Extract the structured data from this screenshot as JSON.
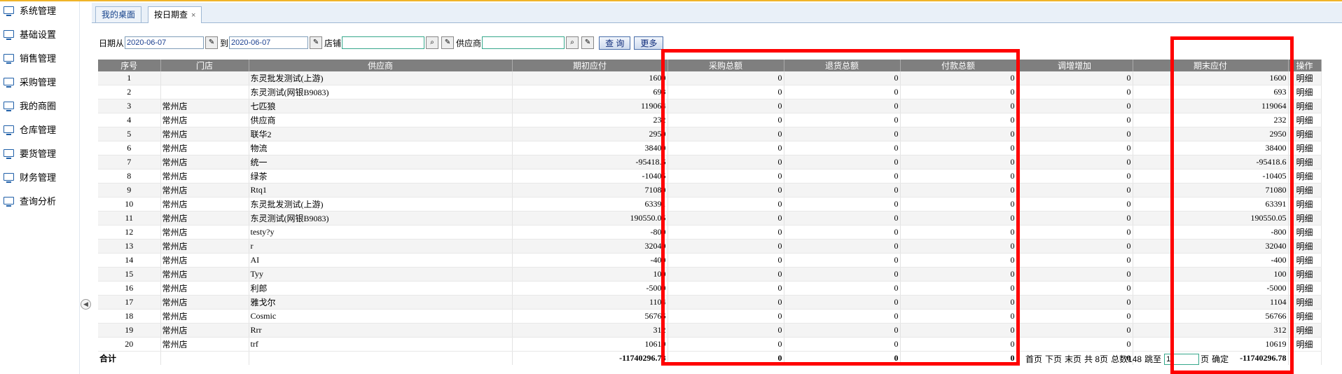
{
  "colors": {
    "accent": "#f0b429",
    "highlight": "#ff0000",
    "header_bg": "#7f7f7f",
    "nav_icon": "#1f5fa8"
  },
  "sidebar": {
    "items": [
      {
        "label": "系统管理",
        "icon": "monitor-icon"
      },
      {
        "label": "基础设置",
        "icon": "monitor-icon"
      },
      {
        "label": "销售管理",
        "icon": "monitor-icon"
      },
      {
        "label": "采购管理",
        "icon": "monitor-icon"
      },
      {
        "label": "我的商圈",
        "icon": "monitor-icon"
      },
      {
        "label": "仓库管理",
        "icon": "monitor-icon"
      },
      {
        "label": "要货管理",
        "icon": "monitor-icon"
      },
      {
        "label": "财务管理",
        "icon": "monitor-icon"
      },
      {
        "label": "查询分析",
        "icon": "monitor-icon"
      }
    ],
    "collapse_glyph": "◀"
  },
  "tabs": [
    {
      "label": "我的桌面"
    },
    {
      "label": "按日期查",
      "close": "×"
    }
  ],
  "filters": {
    "date_from_label": "日期从",
    "date_from": "2020-06-07",
    "date_to_label": "到",
    "date_to": "2020-06-07",
    "store_label": "店铺",
    "store_value": "",
    "supplier_label": "供应商",
    "supplier_value": "",
    "search_button": "查 询",
    "more_button": "更多"
  },
  "table": {
    "columns": [
      "序号",
      "门店",
      "供应商",
      "期初应付",
      "采购总额",
      "退货总额",
      "付款总额",
      "调增增加",
      "期末应付",
      "操作"
    ],
    "rows": [
      [
        "1",
        "",
        "东灵批发测试(上游)",
        "1600",
        "0",
        "0",
        "0",
        "0",
        "1600",
        "明细"
      ],
      [
        "2",
        "",
        "东灵测试(网银B9083)",
        "693",
        "0",
        "0",
        "0",
        "0",
        "693",
        "明细"
      ],
      [
        "3",
        "常州店",
        "七匹狼",
        "119064",
        "0",
        "0",
        "0",
        "0",
        "119064",
        "明细"
      ],
      [
        "4",
        "常州店",
        "供应商",
        "232",
        "0",
        "0",
        "0",
        "0",
        "232",
        "明细"
      ],
      [
        "5",
        "常州店",
        "联华2",
        "2950",
        "0",
        "0",
        "0",
        "0",
        "2950",
        "明细"
      ],
      [
        "6",
        "常州店",
        "物流",
        "38400",
        "0",
        "0",
        "0",
        "0",
        "38400",
        "明细"
      ],
      [
        "7",
        "常州店",
        "统一",
        "-95418.6",
        "0",
        "0",
        "0",
        "0",
        "-95418.6",
        "明细"
      ],
      [
        "8",
        "常州店",
        "绿茶",
        "-10405",
        "0",
        "0",
        "0",
        "0",
        "-10405",
        "明细"
      ],
      [
        "9",
        "常州店",
        "Rtq1",
        "71080",
        "0",
        "0",
        "0",
        "0",
        "71080",
        "明细"
      ],
      [
        "10",
        "常州店",
        "东灵批发测试(上游)",
        "63391",
        "0",
        "0",
        "0",
        "0",
        "63391",
        "明细"
      ],
      [
        "11",
        "常州店",
        "东灵测试(网银B9083)",
        "190550.05",
        "0",
        "0",
        "0",
        "0",
        "190550.05",
        "明细"
      ],
      [
        "12",
        "常州店",
        "testy?y",
        "-800",
        "0",
        "0",
        "0",
        "0",
        "-800",
        "明细"
      ],
      [
        "13",
        "常州店",
        "r",
        "32040",
        "0",
        "0",
        "0",
        "0",
        "32040",
        "明细"
      ],
      [
        "14",
        "常州店",
        "AI",
        "-400",
        "0",
        "0",
        "0",
        "0",
        "-400",
        "明细"
      ],
      [
        "15",
        "常州店",
        "Tyy",
        "100",
        "0",
        "0",
        "0",
        "0",
        "100",
        "明细"
      ],
      [
        "16",
        "常州店",
        "利郎",
        "-5000",
        "0",
        "0",
        "0",
        "0",
        "-5000",
        "明细"
      ],
      [
        "17",
        "常州店",
        "雅戈尔",
        "1104",
        "0",
        "0",
        "0",
        "0",
        "1104",
        "明细"
      ],
      [
        "18",
        "常州店",
        "Cosmic",
        "56766",
        "0",
        "0",
        "0",
        "0",
        "56766",
        "明细"
      ],
      [
        "19",
        "常州店",
        "Rrr",
        "312",
        "0",
        "0",
        "0",
        "0",
        "312",
        "明细"
      ],
      [
        "20",
        "常州店",
        "trf",
        "10619",
        "0",
        "0",
        "0",
        "0",
        "10619",
        "明细"
      ]
    ],
    "total": {
      "label": "合计",
      "opening": "-11740296.78",
      "purchase": "0",
      "returns": "0",
      "payment": "0",
      "adjust": "0",
      "closing": "-11740296.78"
    }
  },
  "pager": {
    "first": "首页",
    "next": "下页",
    "last": "末页",
    "total_pages": "共 8页",
    "total_count": "总数148",
    "goto_label": "跳至",
    "page_value": "1",
    "page_suffix": "页",
    "confirm": "确定"
  }
}
